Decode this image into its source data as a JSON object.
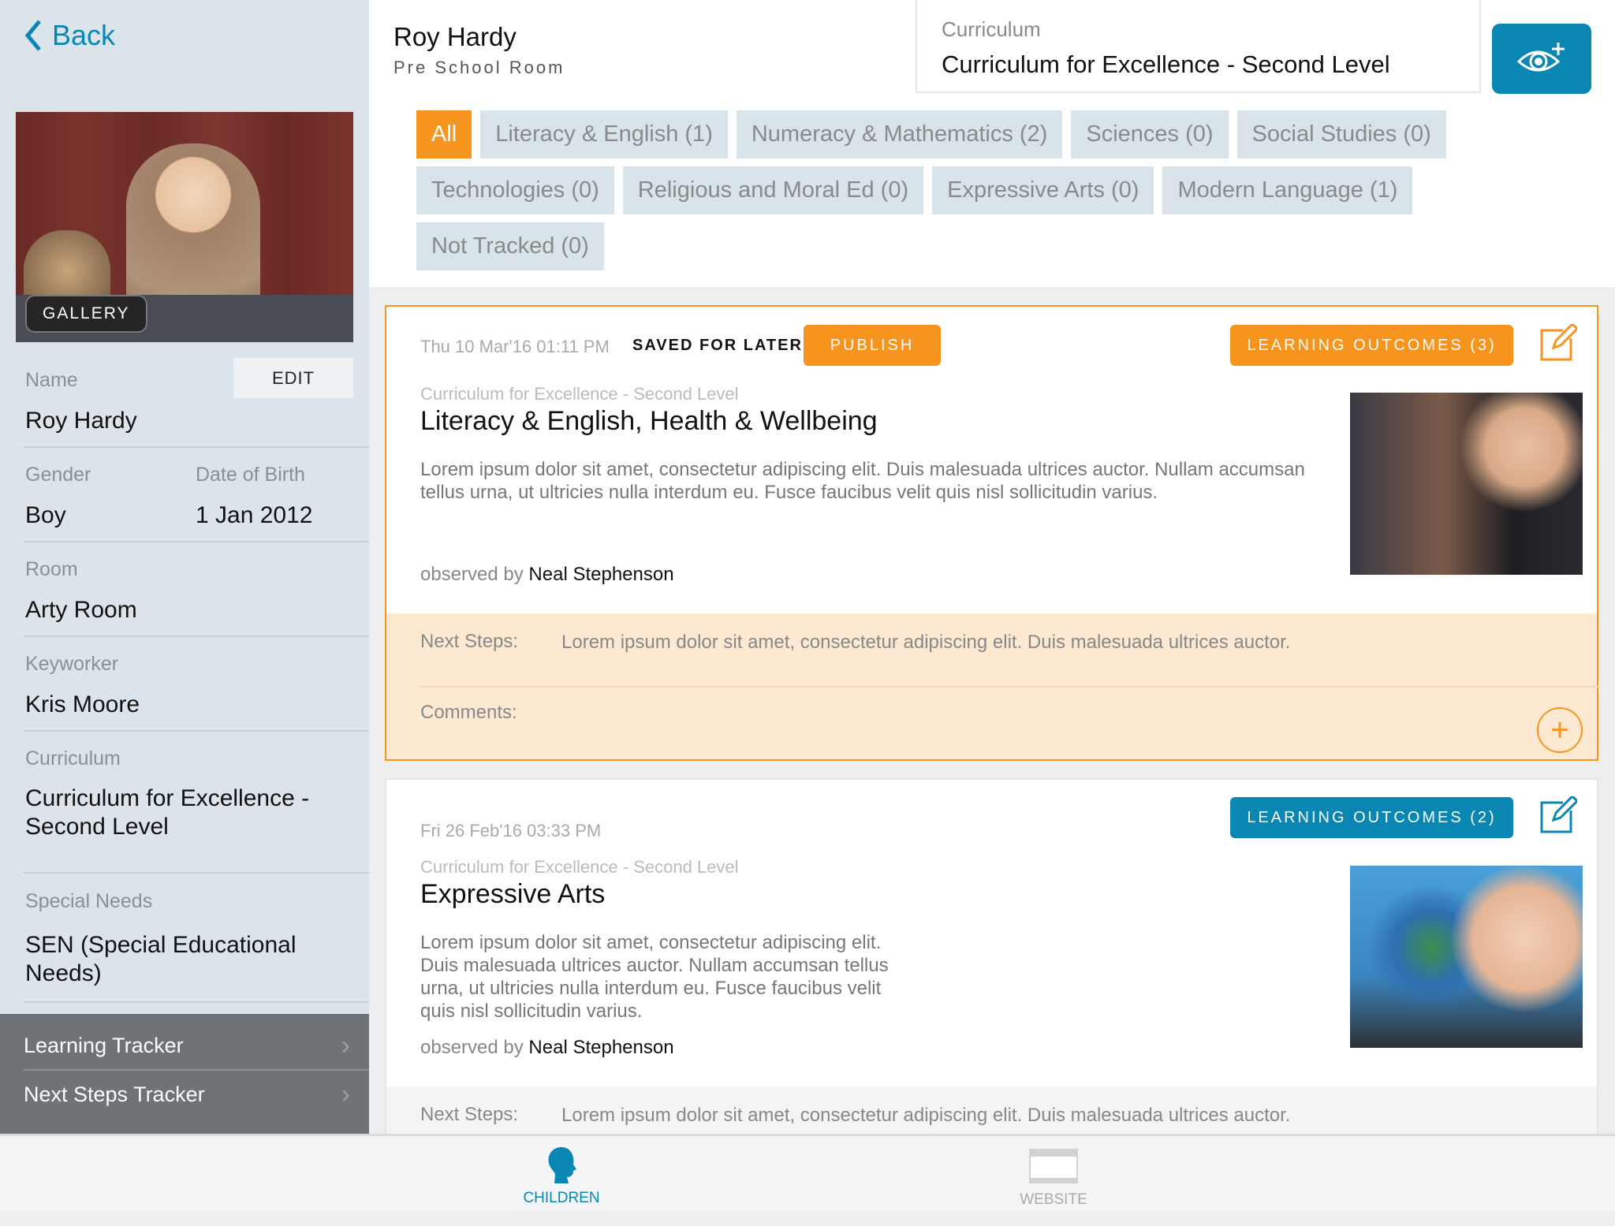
{
  "sidebar": {
    "back_label": "Back",
    "gallery_label": "GALLERY",
    "edit_label": "EDIT",
    "fields": {
      "name_label": "Name",
      "name_value": "Roy Hardy",
      "gender_label": "Gender",
      "gender_value": "Boy",
      "dob_label": "Date of Birth",
      "dob_value": "1 Jan 2012",
      "room_label": "Room",
      "room_value": "Arty Room",
      "keyworker_label": "Keyworker",
      "keyworker_value": "Kris Moore",
      "curriculum_label": "Curriculum",
      "curriculum_value": "Curriculum for Excellence - Second Level",
      "special_needs_label": "Special Needs",
      "special_needs_value": "SEN (Special Educational Needs)"
    },
    "trackers": [
      "Learning Tracker",
      "Next Steps Tracker"
    ]
  },
  "header": {
    "child_name": "Roy Hardy",
    "room": "Pre School Room",
    "curriculum_label": "Curriculum",
    "curriculum_value": "Curriculum for Excellence - Second Level",
    "observe_icon": "eye-plus-icon"
  },
  "filters": [
    {
      "label": "All",
      "active": true
    },
    {
      "label": "Literacy & English (1)"
    },
    {
      "label": "Numeracy & Mathematics (2)"
    },
    {
      "label": "Sciences (0)"
    },
    {
      "label": "Social Studies (0)"
    },
    {
      "label": "Technologies (0)"
    },
    {
      "label": "Religious and Moral Ed (0)"
    },
    {
      "label": "Expressive Arts (0)"
    },
    {
      "label": "Modern Language (1)"
    },
    {
      "label": "Not Tracked (0)"
    }
  ],
  "observations": [
    {
      "date": "Thu 10 Mar'16 01:11 PM",
      "status": "SAVED FOR LATER",
      "publish_label": "PUBLISH",
      "outcomes_label": "LEARNING OUTCOMES (3)",
      "curriculum": "Curriculum for Excellence - Second Level",
      "title": "Literacy & English, Health & Wellbeing",
      "body": "Lorem ipsum dolor sit amet, consectetur adipiscing elit. Duis malesuada ultrices auctor. Nullam accumsan tellus urna, ut ultricies nulla interdum eu. Fusce faucibus velit quis nisl sollicitudin varius.",
      "observed_prefix": "observed by",
      "observer": "Neal Stephenson",
      "next_steps_label": "Next Steps:",
      "next_steps": "Lorem ipsum dolor sit amet, consectetur adipiscing elit. Duis malesuada ultrices auctor.",
      "comments_label": "Comments:"
    },
    {
      "date": "Fri 26 Feb'16 03:33 PM",
      "outcomes_label": "LEARNING OUTCOMES (2)",
      "curriculum": "Curriculum for Excellence - Second Level",
      "title": "Expressive Arts",
      "body": "Lorem ipsum dolor sit amet, consectetur adipiscing elit. Duis malesuada ultrices auctor. Nullam accumsan tellus urna, ut ultricies nulla interdum eu. Fusce faucibus velit quis nisl sollicitudin varius.",
      "observed_prefix": "observed by",
      "observer": "Neal Stephenson",
      "next_steps_label": "Next Steps:",
      "next_steps": "Lorem ipsum dolor sit amet, consectetur adipiscing elit. Duis malesuada ultrices auctor."
    }
  ],
  "tabbar": [
    {
      "label": "CHILDREN",
      "icon": "child-head-icon",
      "active": true
    },
    {
      "label": "WEBSITE",
      "icon": "browser-window-icon"
    }
  ],
  "colors": {
    "accent_orange": "#f7941d",
    "accent_blue": "#0a86b3",
    "sidebar_bg": "#dae4ea",
    "chip_bg": "#d9e3ea",
    "next_steps_bg": "#fde9d2"
  }
}
